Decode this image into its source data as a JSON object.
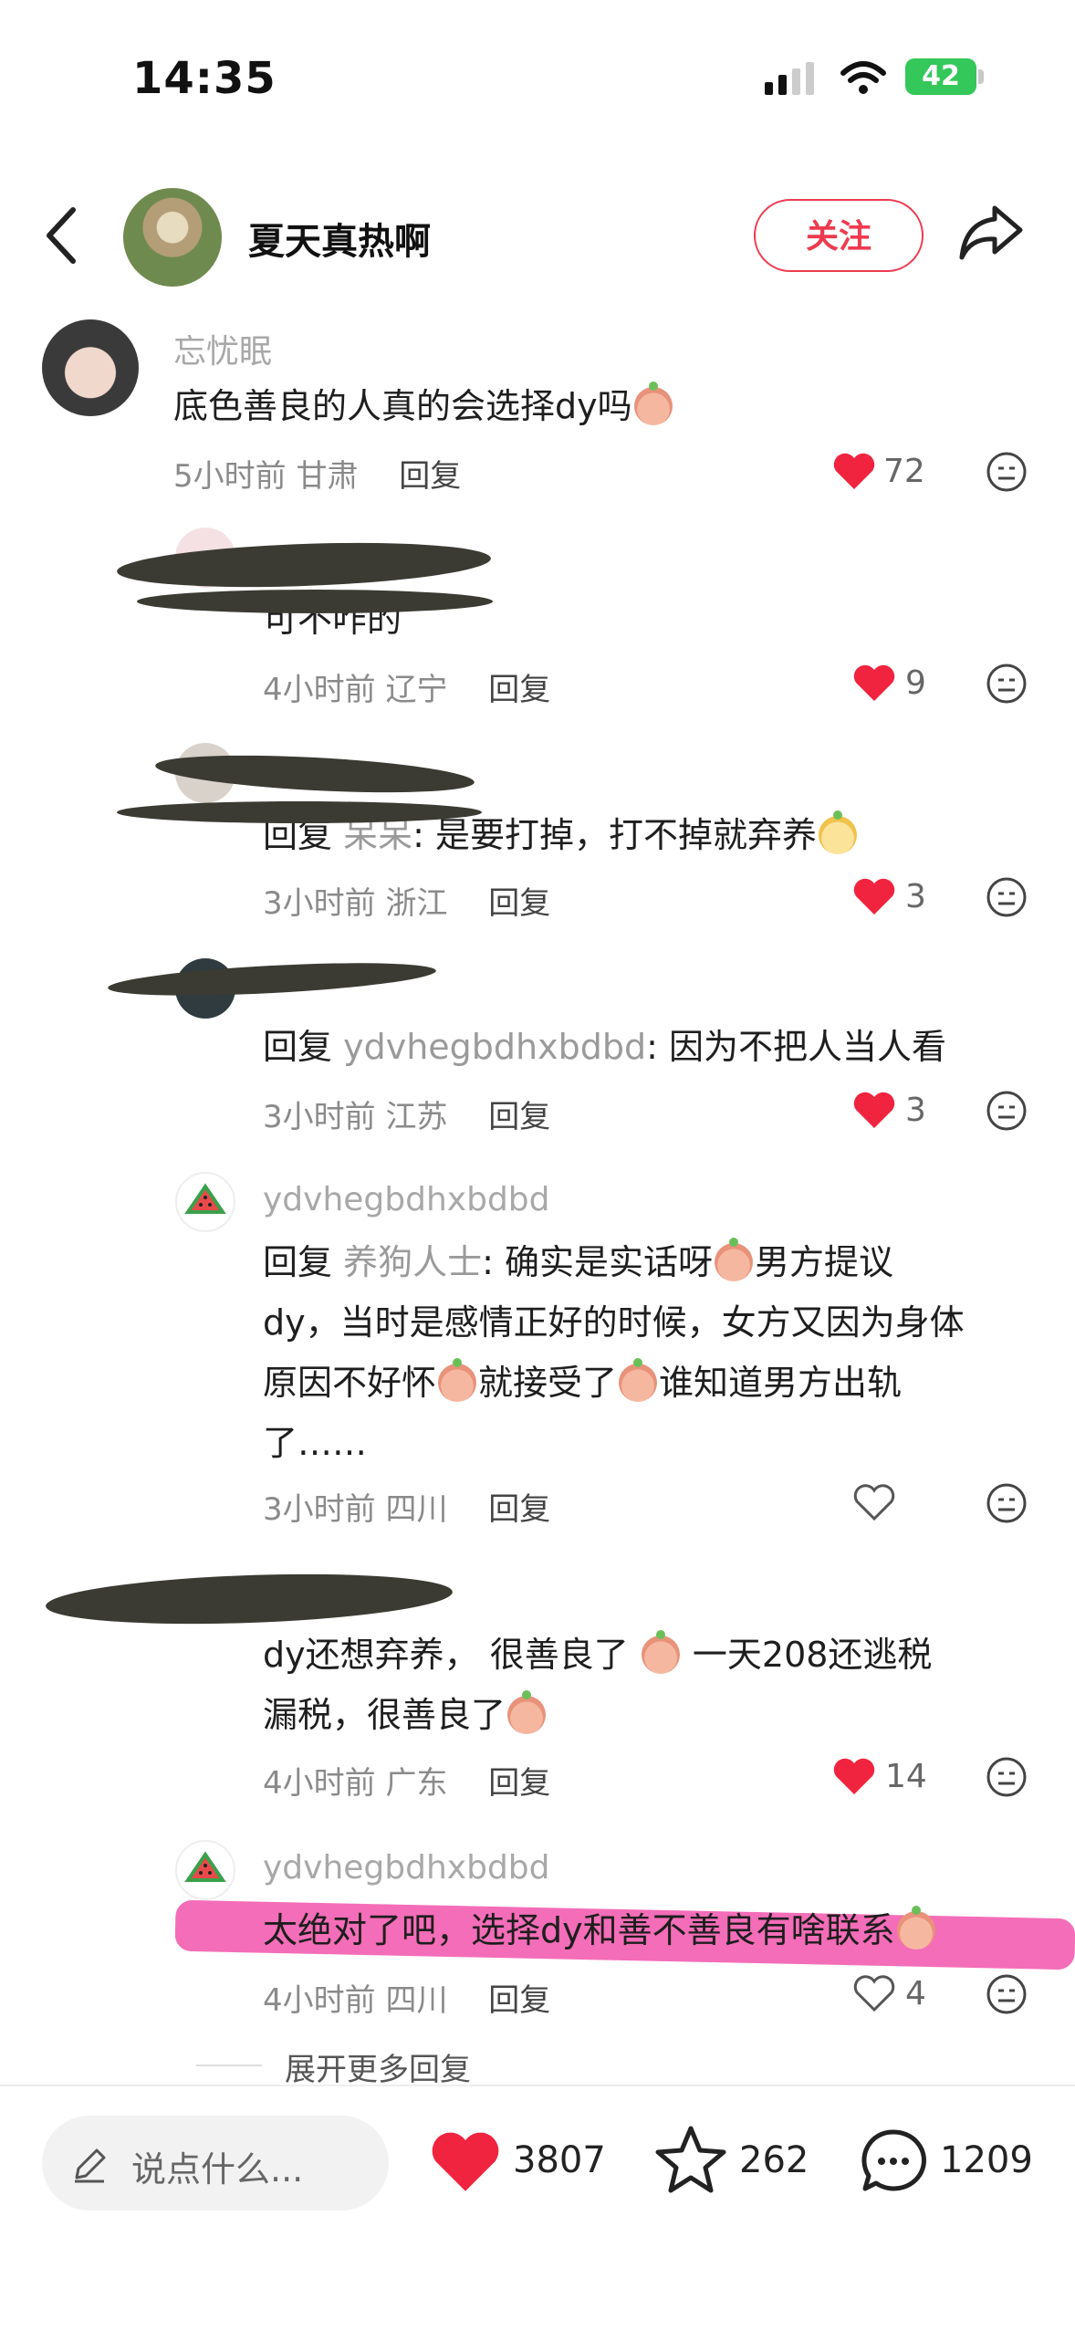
{
  "status": {
    "time": "14:35",
    "battery": "42"
  },
  "header": {
    "author": "夏天真热啊",
    "follow": "关注"
  },
  "comments": [
    {
      "name": "忘忧眠",
      "text": "底色善良的人真的会选择dy吗",
      "time": "5小时前",
      "location": "甘肃",
      "reply": "回复",
      "likes": "72"
    },
    {
      "name": "",
      "text": "可不咋的",
      "time": "4小时前",
      "location": "辽宁",
      "reply": "回复",
      "likes": "9"
    },
    {
      "name": "",
      "prefix": "回复",
      "reply_to": "呆呆",
      "text": ": 是要打掉，打不掉就弃养",
      "time": "3小时前",
      "location": "浙江",
      "reply": "回复",
      "likes": "3"
    },
    {
      "name": "",
      "prefix": "回复",
      "reply_to": "ydvhegbdhxbdbd",
      "text": ": 因为不把人当人看",
      "time": "3小时前",
      "location": "江苏",
      "reply": "回复",
      "likes": "3"
    },
    {
      "name": "ydvhegbdhxbdbd",
      "prefix": "回复",
      "reply_to": "养狗人士",
      "text1": ": 确实是实话呀",
      "text2": "男方提议",
      "line2": "dy，当时是感情正好的时候，女方又因为身体",
      "line3a": "原因不好怀",
      "line3b": "就接受了",
      "line3c": "谁知道男方出轨",
      "line4": "了……",
      "time": "3小时前",
      "location": "四川",
      "reply": "回复",
      "likes": ""
    },
    {
      "name": "",
      "line1a": "dy还想弃养，  很善良了",
      "line1b": "一天208还逃税",
      "line2": "漏税，很善良了",
      "time": "4小时前",
      "location": "广东",
      "reply": "回复",
      "likes": "14"
    },
    {
      "name": "ydvhegbdhxbdbd",
      "text": "太绝对了吧，选择dy和善不善良有啥联系",
      "time": "4小时前",
      "location": "四川",
      "reply": "回复",
      "likes": "4"
    }
  ],
  "expand_more": "展开更多回复",
  "bottom": {
    "placeholder": "说点什么...",
    "likes": "3807",
    "favorites": "262",
    "comments": "1209"
  },
  "colors": {
    "accent": "#ee3a4f",
    "like_red": "#f0243e"
  }
}
